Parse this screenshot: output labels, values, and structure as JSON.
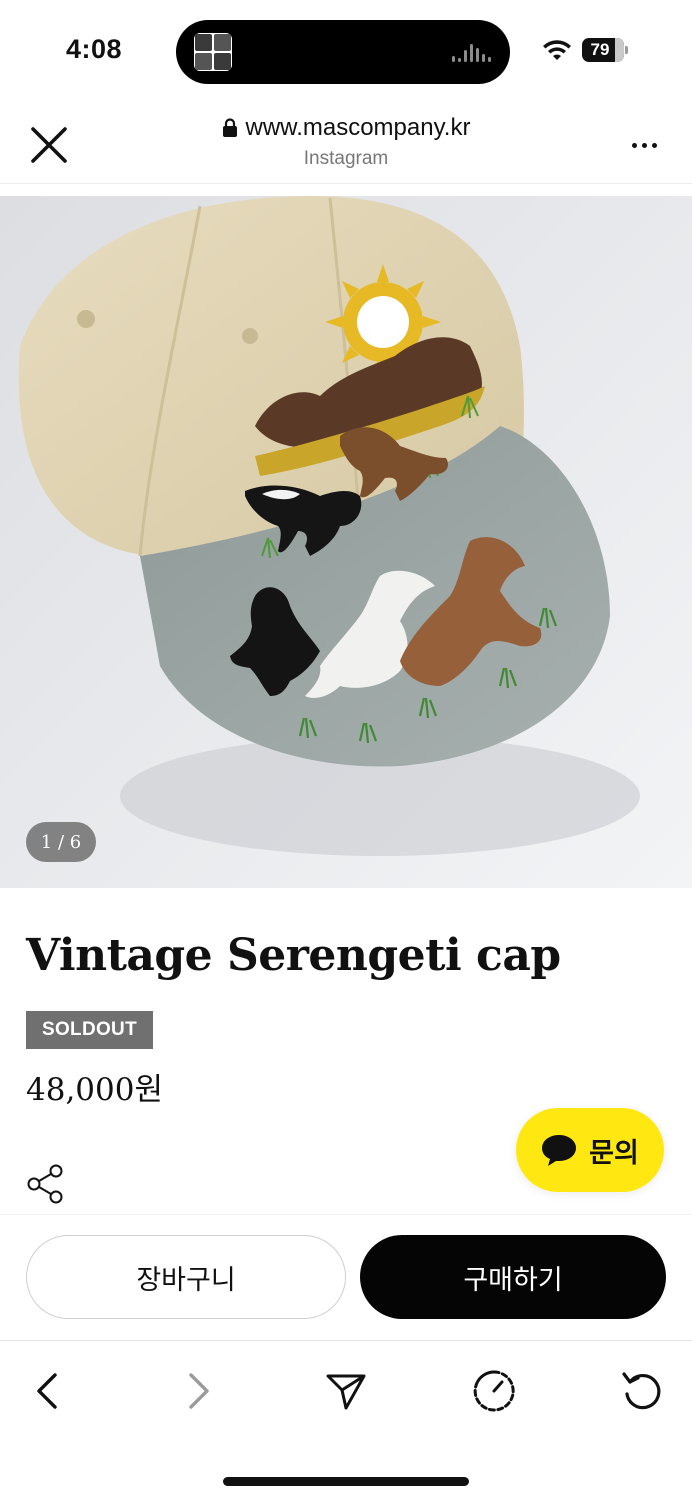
{
  "status_bar": {
    "time": "4:08",
    "battery": "79",
    "battery_level": 0.79,
    "icons": [
      "wifi-icon",
      "battery-icon",
      "audio-wave-icon"
    ]
  },
  "browser": {
    "url": "www.mascompany.kr",
    "source": "Instagram",
    "icons": [
      "close-icon",
      "lock-icon",
      "more-icon"
    ]
  },
  "product": {
    "image_counter": "1 / 6",
    "title": "Vintage Serengeti cap",
    "status_badge": "SOLDOUT",
    "price": "48,000원",
    "share_icon": "share-icon"
  },
  "chat": {
    "label": "문의",
    "icon": "speech-bubble-icon",
    "color": "#ffe812"
  },
  "actions": {
    "cart_label": "장바구니",
    "buy_label": "구매하기"
  },
  "toolbar": {
    "icons": [
      "back-icon",
      "forward-icon",
      "send-icon",
      "speed-icon",
      "reload-icon"
    ]
  },
  "colors": {
    "badge_bg": "#707070",
    "buy_bg": "#050505",
    "chat_bg": "#ffe812"
  }
}
